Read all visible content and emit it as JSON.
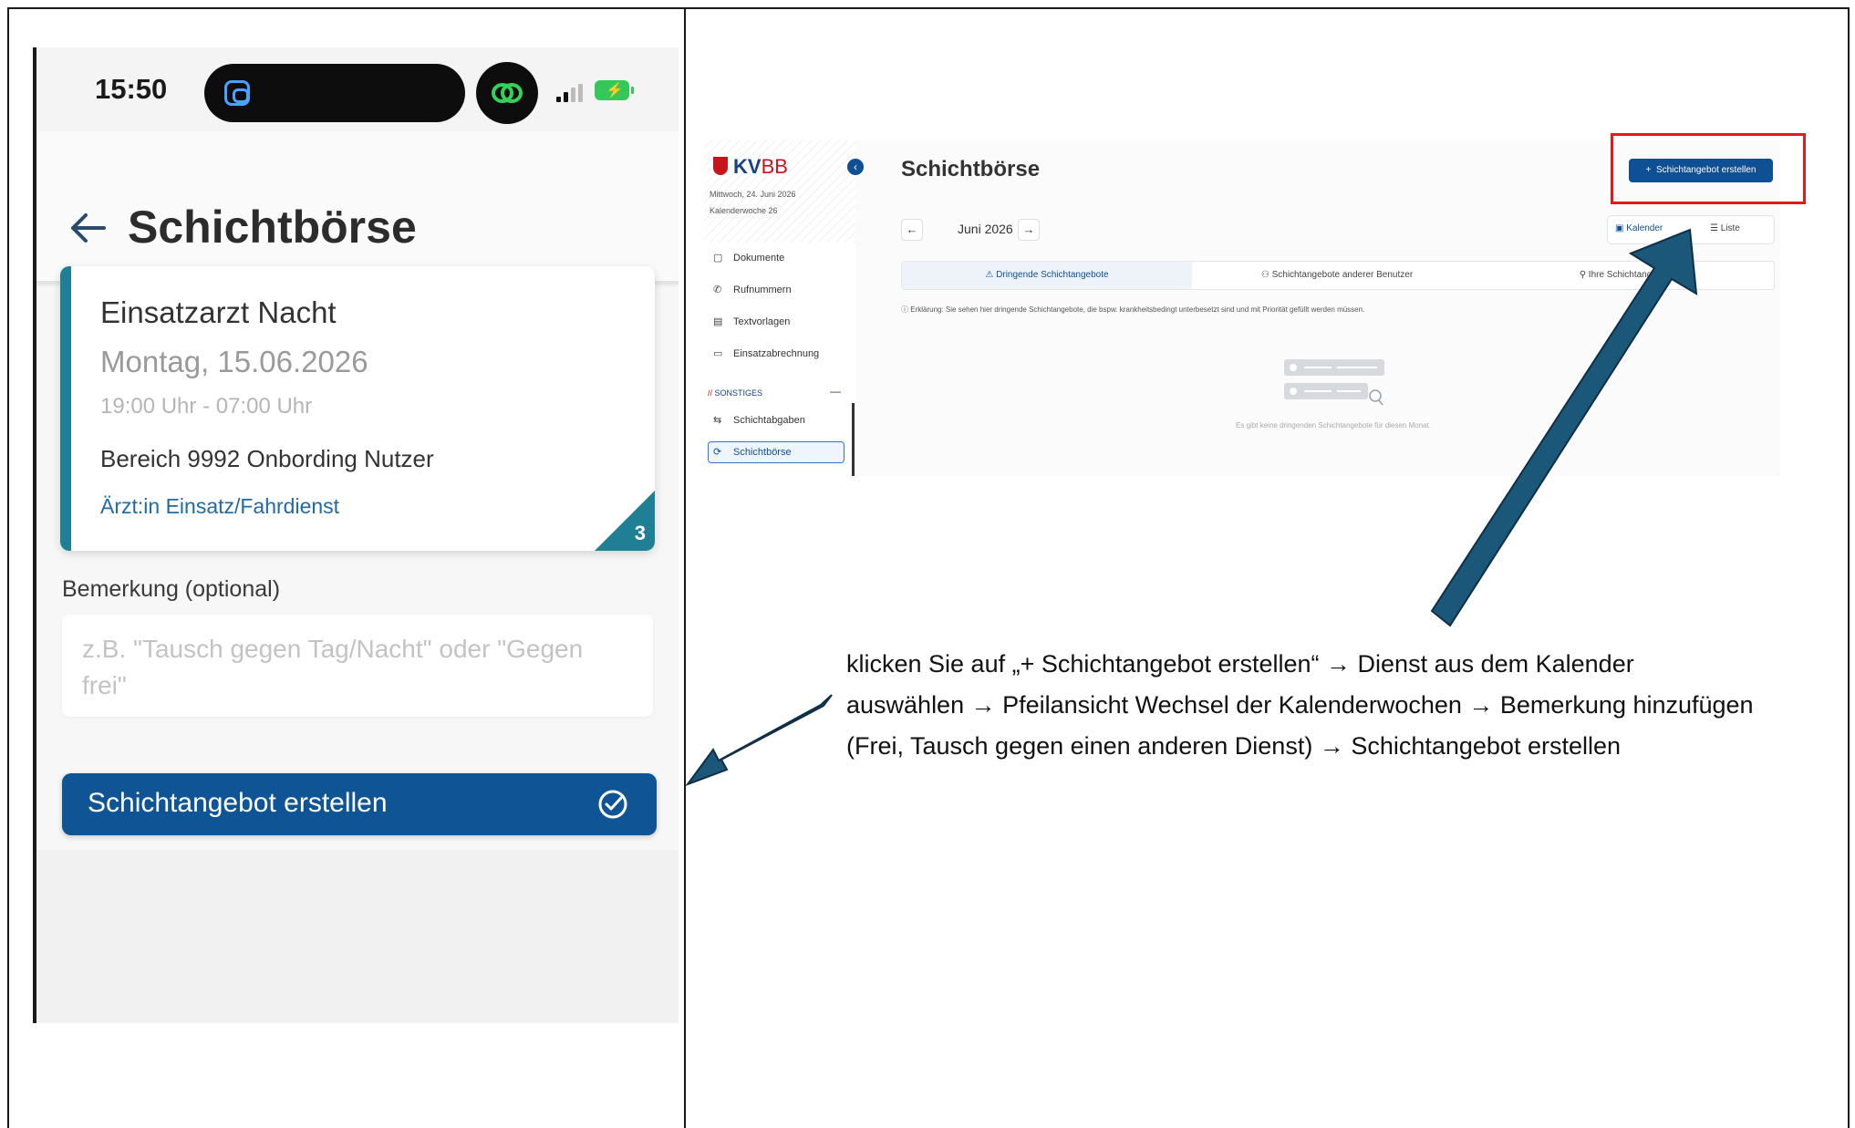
{
  "phone": {
    "status_time": "15:50",
    "page_title": "Schichtbörse",
    "card": {
      "title": "Einsatzarzt Nacht",
      "date": "Montag, 15.06.2026",
      "time": "19:00 Uhr - 07:00 Uhr",
      "area": "Bereich 9992 Onbording Nutzer",
      "role": "Ärzt:in Einsatz/Fahrdienst",
      "badge": "3",
      "accent_color": "#1f7f94"
    },
    "remark": {
      "label": "Bemerkung (optional)",
      "placeholder": "z.B. \"Tausch gegen Tag/Nacht\" oder \"Gegen frei\""
    },
    "submit_button": "Schichtangebot erstellen",
    "primary_color": "#0f5596"
  },
  "web": {
    "logo_kv": "KV",
    "logo_bb": "BB",
    "date": "Mittwoch, 24. Juni 2026",
    "week": "Kalenderwoche 26",
    "sidebar_items": [
      "Dokumente",
      "Rufnummern",
      "Textvorlagen",
      "Einsatzabrechnung"
    ],
    "section_label": "SONSTIGES",
    "section_items": [
      "Schichtabgaben",
      "Schichtbörse"
    ],
    "title": "Schichtbörse",
    "new_offer_button": "Schichtangebot erstellen",
    "month": "Juni 2026",
    "view_calendar": "Kalender",
    "view_list": "Liste",
    "tabs": [
      "Dringende Schichtangebote",
      "Schichtangebote anderer Benutzer",
      "Ihre Schichtangebote"
    ],
    "explanation": "Erklärung: Sie sehen hier dringende Schichtangebote, die bspw. krankheitsbedingt unterbesetzt sind und mit Priorität gefüllt werden müssen.",
    "empty_message": "Es gibt keine dringenden Schichtangebote für diesen Monat."
  },
  "instruction": "klicken Sie auf „+ Schichtangebot erstellen“ → Dienst aus dem Kalender auswählen → Pfeilansicht Wechsel der Kalenderwochen → Bemerkung hinzufügen (Frei, Tausch gegen einen anderen Dienst) → Schichtangebot erstellen",
  "colors": {
    "highlight_red": "#e11b1b",
    "arrow_blue": "#1b5778"
  }
}
